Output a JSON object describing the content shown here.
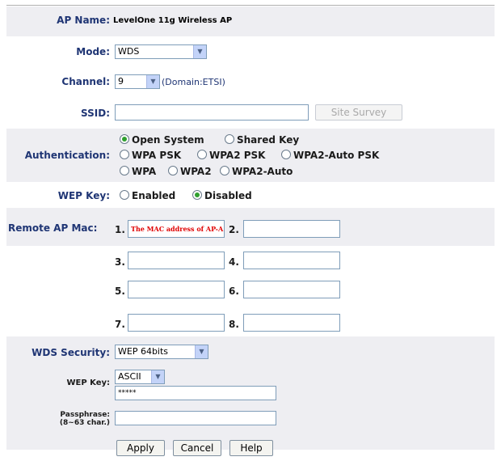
{
  "ap_name": {
    "label": "AP Name:",
    "value": "LevelOne 11g Wireless AP"
  },
  "mode": {
    "label": "Mode:",
    "selected": "WDS"
  },
  "channel": {
    "label": "Channel:",
    "selected": "9",
    "domain_note": "(Domain:ETSI)"
  },
  "ssid": {
    "label": "SSID:",
    "value": "",
    "site_survey_label": "Site Survey"
  },
  "authentication": {
    "label": "Authentication:",
    "options": [
      {
        "label": "Open System",
        "selected": true
      },
      {
        "label": "Shared Key",
        "selected": false
      },
      {
        "label": "WPA PSK",
        "selected": false
      },
      {
        "label": "WPA2 PSK",
        "selected": false
      },
      {
        "label": "WPA2-Auto PSK",
        "selected": false
      },
      {
        "label": "WPA",
        "selected": false
      },
      {
        "label": "WPA2",
        "selected": false
      },
      {
        "label": "WPA2-Auto",
        "selected": false
      }
    ]
  },
  "wep_key": {
    "label": "WEP Key:",
    "options": [
      {
        "label": "Enabled",
        "selected": false
      },
      {
        "label": "Disabled",
        "selected": true
      }
    ]
  },
  "remote_ap_mac": {
    "label": "Remote AP Mac:",
    "entries": [
      {
        "num": "1.",
        "value": "The MAC address of AP-A"
      },
      {
        "num": "2.",
        "value": ""
      },
      {
        "num": "3.",
        "value": ""
      },
      {
        "num": "4.",
        "value": ""
      },
      {
        "num": "5.",
        "value": ""
      },
      {
        "num": "6.",
        "value": ""
      },
      {
        "num": "7.",
        "value": ""
      },
      {
        "num": "8.",
        "value": ""
      }
    ]
  },
  "wds_security": {
    "label": "WDS Security:",
    "selected": "WEP 64bits",
    "wep_key_label": "WEP Key:",
    "key_format": "ASCII",
    "wep_key_value": "*****",
    "passphrase_label_line1": "Passphrase:",
    "passphrase_label_line2": "(8~63 char.)",
    "passphrase_value": ""
  },
  "buttons": {
    "apply": "Apply",
    "cancel": "Cancel",
    "help": "Help"
  },
  "colors": {
    "label": "#1f3574",
    "band": "#eeeef2",
    "radio_on": "#2f9f2f",
    "mac_text": "#e00000"
  }
}
